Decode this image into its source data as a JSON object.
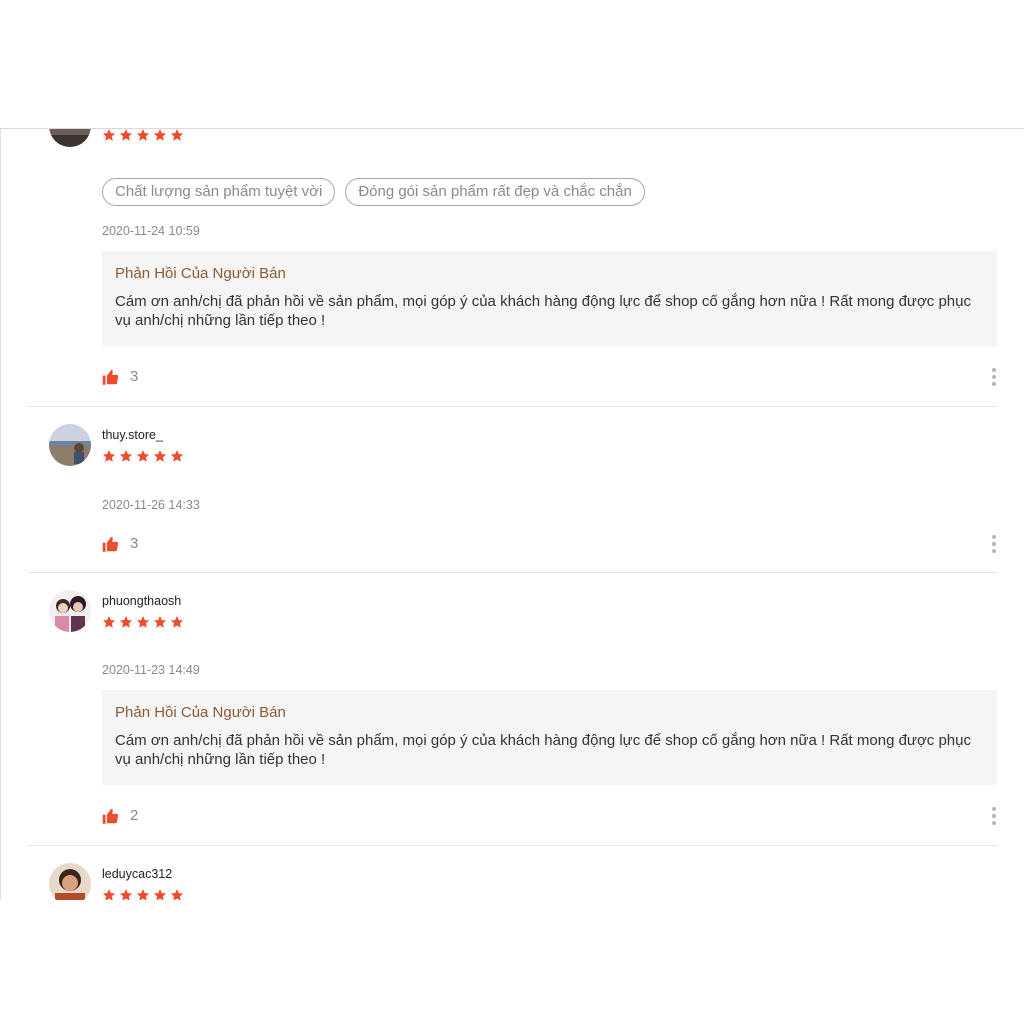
{
  "colors": {
    "star": "#ee4d2d",
    "like": "#ee4d2d",
    "reply_title": "#8a5a34"
  },
  "reviews": [
    {
      "username": "",
      "rating": 5,
      "tags": [
        "Chất lượng sản phẩm tuyệt vời",
        "Đóng gói sản phẩm rất đẹp và chắc chắn"
      ],
      "date": "2020-11-24 10:59",
      "seller_reply": {
        "title": "Phản Hồi Của Người Bán",
        "text": "Cám ơn anh/chị đã phản hồi về sản phẩm, mọi góp ý của khách hàng động lực để shop cố gắng hơn nữa ! Rất mong được phục vụ anh/chị những lần tiếp theo !"
      },
      "likes": "3"
    },
    {
      "username": "thuy.store_",
      "rating": 5,
      "date": "2020-11-26 14:33",
      "likes": "3"
    },
    {
      "username": "phuongthaosh",
      "rating": 5,
      "date": "2020-11-23 14:49",
      "seller_reply": {
        "title": "Phản Hồi Của Người Bán",
        "text": "Cám ơn anh/chị đã phản hồi về sản phẩm, mọi góp ý của khách hàng động lực để shop cố gắng hơn nữa ! Rất mong được phục vụ anh/chị những lần tiếp theo !"
      },
      "likes": "2"
    },
    {
      "username": "leduycac312",
      "rating": 5
    }
  ]
}
